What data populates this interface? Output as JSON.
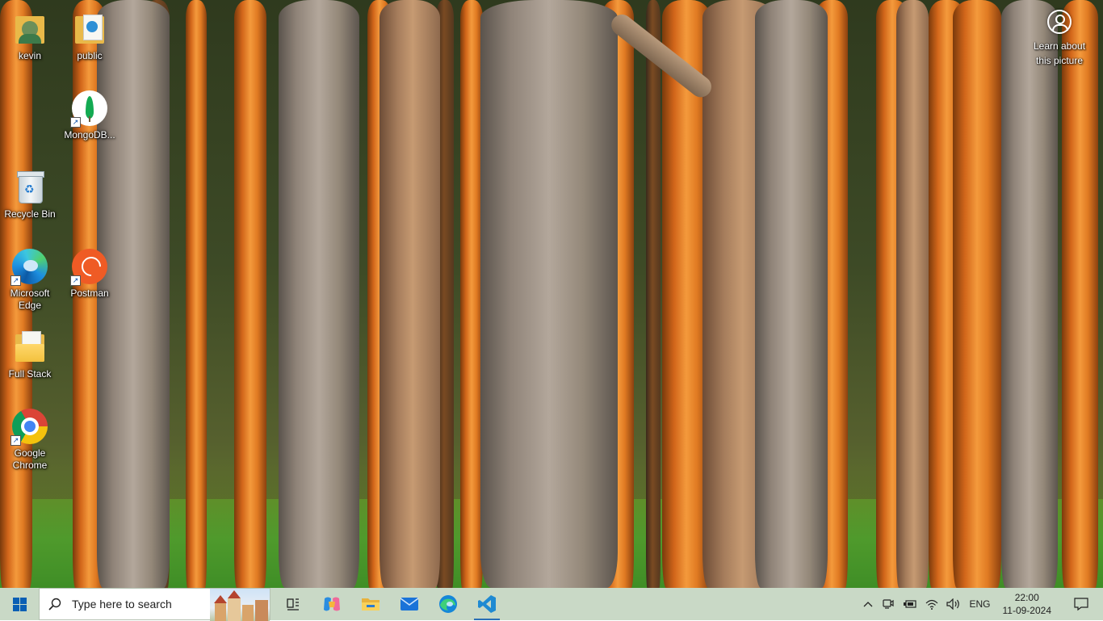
{
  "desktop": {
    "icons": [
      {
        "name": "kevin"
      },
      {
        "name": "public"
      },
      {
        "name": "MongoDB..."
      },
      {
        "name": "Recycle Bin"
      },
      {
        "name": "Microsoft Edge"
      },
      {
        "name": "Postman"
      },
      {
        "name": "Full Stack"
      },
      {
        "name": "Google Chrome"
      }
    ],
    "learn_about": "Learn about this picture"
  },
  "taskbar": {
    "search_placeholder": "Type here to search",
    "pinned": [
      "task-view",
      "copilot",
      "file-explorer",
      "mail",
      "microsoft-edge",
      "visual-studio-code"
    ],
    "active_app": "visual-studio-code",
    "tray": {
      "language": "ENG",
      "time": "22:00",
      "date": "11-09-2024"
    }
  },
  "colors": {
    "taskbar_bg": "#c9d9c6",
    "accent": "#0a5fb4"
  }
}
